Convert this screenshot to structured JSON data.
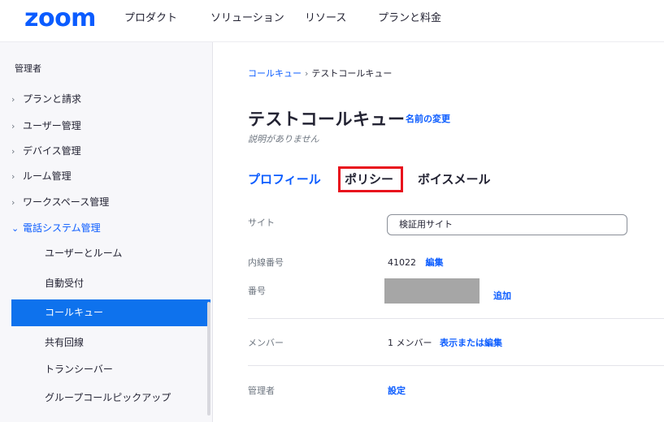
{
  "brand": {
    "logo": "zoom",
    "accent": "#0b5cff",
    "highlight": "#e8101c"
  },
  "topnav": {
    "items": [
      "プロダクト",
      "ソリューション",
      "リソース",
      "プランと料金"
    ]
  },
  "sidebar": {
    "heading": "管理者",
    "items": [
      {
        "label": "プランと請求",
        "icon": "chevron-right-icon"
      },
      {
        "label": "ユーザー管理",
        "icon": "chevron-right-icon"
      },
      {
        "label": "デバイス管理",
        "icon": "chevron-right-icon"
      },
      {
        "label": "ルーム管理",
        "icon": "chevron-right-icon"
      },
      {
        "label": "ワークスペース管理",
        "icon": "chevron-right-icon"
      },
      {
        "label": "電話システム管理",
        "icon": "chevron-down-icon"
      }
    ],
    "subitems": [
      "ユーザーとルーム",
      "自動受付",
      "コールキュー",
      "共有回線",
      "トランシーバー",
      "グループコールピックアップ"
    ],
    "active_subitem": "コールキュー"
  },
  "breadcrumb": {
    "parent": "コールキュー",
    "separator": "›",
    "current": "テストコールキュー"
  },
  "page": {
    "title": "テストコールキュー",
    "rename_label": "名前の変更",
    "description": "説明がありません"
  },
  "tabs": [
    "プロフィール",
    "ポリシー",
    "ボイスメール"
  ],
  "details": {
    "site_label": "サイト",
    "site_value": "検証用サイト",
    "extension_label": "内線番号",
    "extension_value": "41022",
    "extension_edit": "編集",
    "number_label": "番号",
    "number_add": "追加",
    "members_label": "メンバー",
    "members_value": "1 メンバー",
    "members_link": "表示または編集",
    "admin_label": "管理者",
    "admin_link": "設定"
  }
}
